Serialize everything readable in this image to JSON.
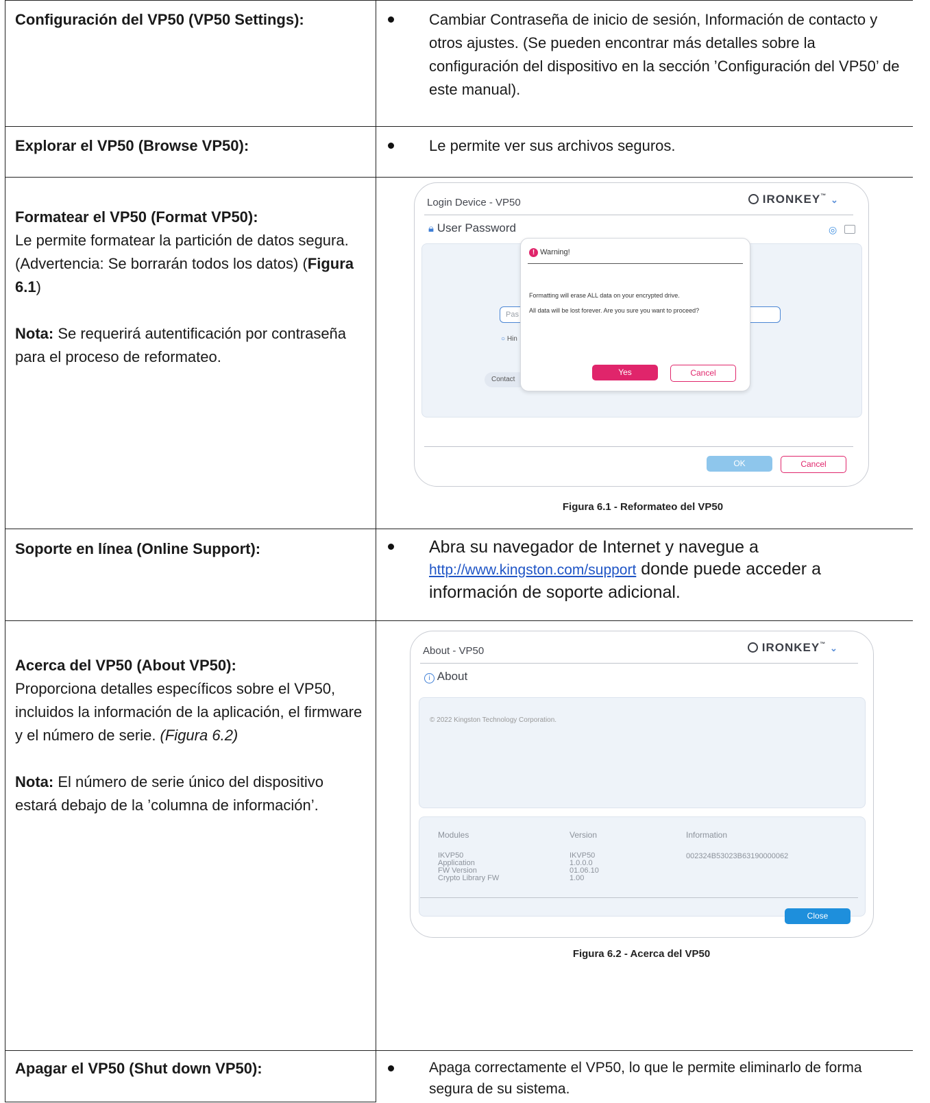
{
  "rows": {
    "settings": {
      "label": "Configuración del VP50 (VP50 Settings):",
      "desc": "Cambiar Contraseña de inicio de sesión, Información de contacto y otros ajustes. (Se pueden encontrar más detalles sobre la configuración del dispositivo en la sección ’Configuración del VP50’ de este manual)."
    },
    "browse": {
      "label": "Explorar el VP50 (Browse VP50):",
      "desc": "Le permite ver sus archivos seguros."
    },
    "format": {
      "label": "Formatear el VP50 (Format VP50):",
      "text1": "Le permite formatear la partición de datos segura. (Advertencia: Se borrarán todos los datos) (",
      "figref": "Figura 6.1",
      "text1_end": ")",
      "note_label": "Nota:",
      "note": " Se requerirá autentificación por contraseña para el proceso de reformateo.",
      "caption": "Figura 6.1 - Reformateo del VP50"
    },
    "support": {
      "label": "Soporte en línea (Online Support):",
      "desc1": "Abra su navegador de Internet y navegue a",
      "link": "http://www.kingston.com/support",
      "desc2": " donde puede acceder a información de soporte adicional."
    },
    "about": {
      "label": "Acerca del VP50 (About VP50):",
      "text1": "Proporciona detalles específicos sobre el VP50, incluidos la información de la aplicación, el firmware y el número de serie. ",
      "figref": "(Figura 6.2)",
      "note_label": "Nota:",
      "note": " El número de serie único del dispositivo estará debajo de la ’columna de información’.",
      "caption": "Figura 6.2 - Acerca del VP50"
    },
    "shutdown": {
      "label": "Apagar el VP50 (Shut down VP50):",
      "desc": "Apaga correctamente el VP50, lo que le permite eliminarlo de forma segura de su sistema."
    }
  },
  "login_dialog": {
    "title": "Login Device - VP50",
    "brand": "IRONKEY",
    "section": "User Password",
    "password_placeholder": "Pas",
    "hint": "Hin",
    "contact": "Contact",
    "warning": {
      "title": "Warning!",
      "line1": "Formatting will erase ALL data on your encrypted drive.",
      "line2": "All data will be lost forever. Are you sure you want to proceed?",
      "yes": "Yes",
      "cancel": "Cancel"
    },
    "ok": "OK",
    "cancel": "Cancel"
  },
  "about_dialog": {
    "title": "About - VP50",
    "brand": "IRONKEY",
    "section": "About",
    "copyright": "© 2022 Kingston Technology Corporation.",
    "headers": [
      "Modules",
      "Version",
      "Information"
    ],
    "modules": [
      "IKVP50",
      "Application",
      "FW Version",
      "Crypto Library FW"
    ],
    "versions": [
      "IKVP50",
      "1.0.0.0",
      "01.06.10",
      "1.00"
    ],
    "info": "002324B53023B63190000062",
    "close": "Close"
  },
  "colors": {
    "accent_pink": "#e0256b",
    "accent_blue": "#1e8fdc",
    "ok_blue": "#8ec6ec"
  }
}
